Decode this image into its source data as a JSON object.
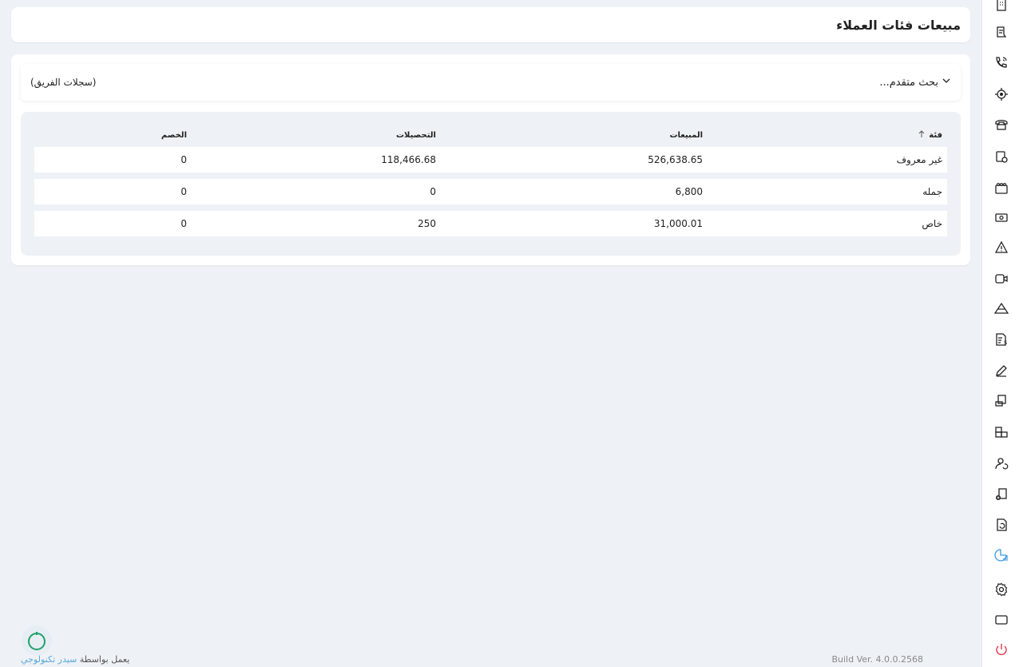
{
  "page": {
    "title": "مبيعات فئات العملاء"
  },
  "search": {
    "toggle_label": "بحث متقدم...",
    "team_records_label": "(سجلات الفريق)"
  },
  "table": {
    "headers": {
      "category": "فئة",
      "sales": "المبيعات",
      "collections": "التحصيلات",
      "discount": "الخصم"
    },
    "rows": [
      {
        "category": "غير معروف",
        "sales": "526,638.65",
        "collections": "118,466.68",
        "discount": "0"
      },
      {
        "category": "جمله",
        "sales": "6,800",
        "collections": "0",
        "discount": "0"
      },
      {
        "category": "خاص",
        "sales": "31,000.01",
        "collections": "250",
        "discount": "0"
      }
    ]
  },
  "footer": {
    "build": "Build Ver. 4.0.0.2568",
    "powered_prefix": "يعمل بواسطة",
    "powered_link": "سيدر تكنولوجي"
  },
  "colors": {
    "active_icon": "#3b9ae1",
    "logout_icon": "#e0364a",
    "spinner": "#21a06b"
  },
  "sidebar": {
    "icons": [
      "building-icon",
      "ticket-icon",
      "phone-call-icon",
      "location-target-icon",
      "telephone-icon",
      "document-gear-icon",
      "film-reel-icon",
      "cash-icon",
      "warning-icon",
      "video-call-icon",
      "mountain-icon",
      "invoice-icon",
      "pen-icon",
      "truck-document-icon",
      "boxes-icon",
      "user-refresh-icon",
      "document-add-icon",
      "document-refresh-icon",
      "chart-report-icon",
      "settings-icon",
      "screen-icon",
      "power-icon"
    ]
  }
}
